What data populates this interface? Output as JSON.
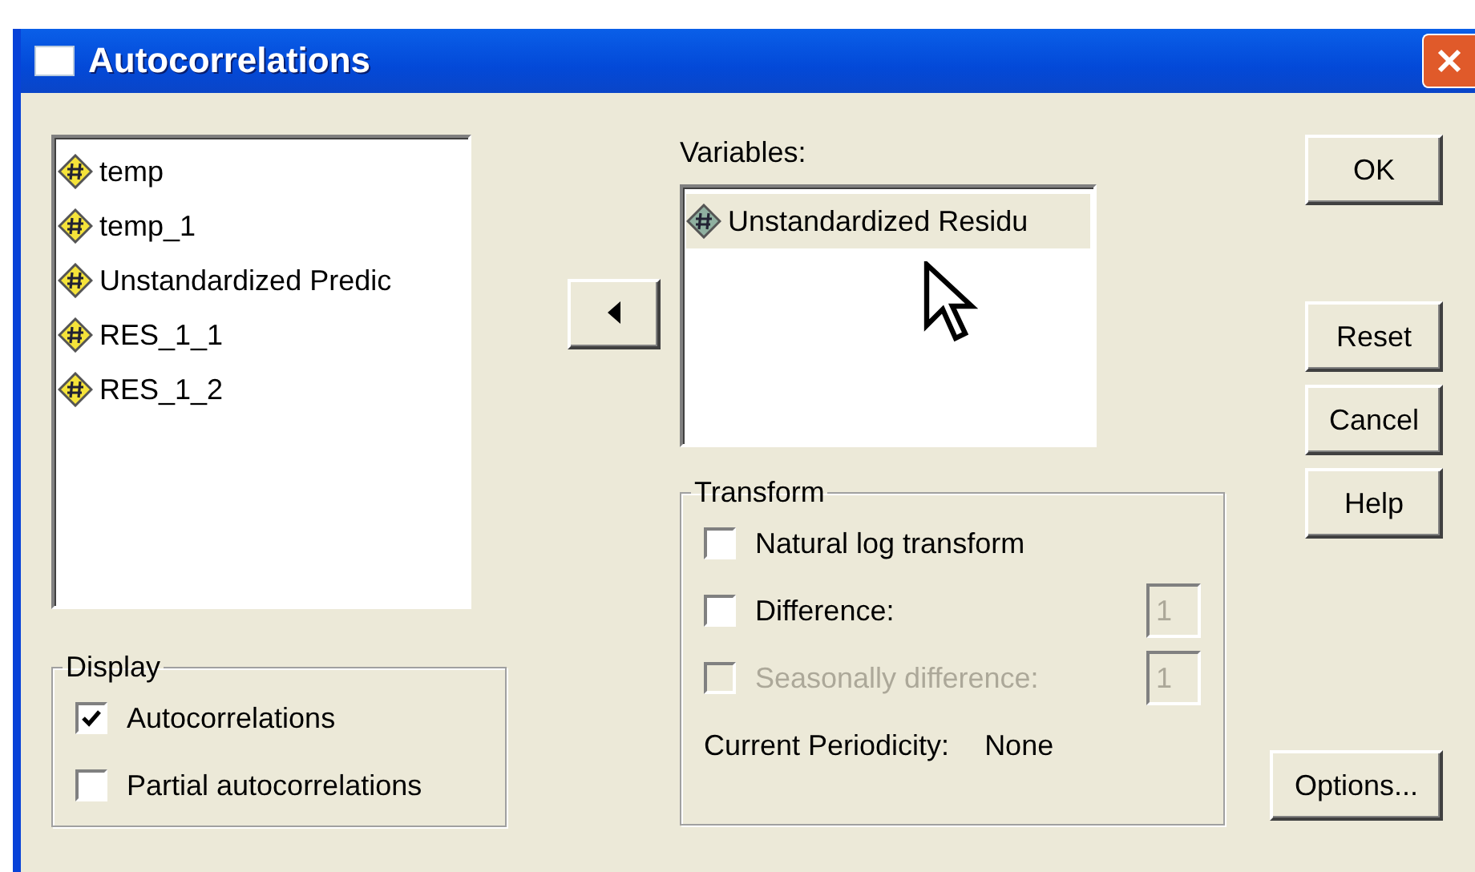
{
  "window": {
    "title": "Autocorrelations"
  },
  "source_list": {
    "items": [
      {
        "label": "temp",
        "selected": false
      },
      {
        "label": "temp_1",
        "selected": false
      },
      {
        "label": "Unstandardized Predic",
        "selected": false
      },
      {
        "label": "RES_1_1",
        "selected": false
      },
      {
        "label": "RES_1_2",
        "selected": false
      }
    ]
  },
  "variables": {
    "label": "Variables:",
    "items": [
      {
        "label": "Unstandardized Residu",
        "selected": true
      }
    ]
  },
  "display": {
    "legend": "Display",
    "options": [
      {
        "label": "Autocorrelations",
        "checked": true,
        "disabled": false
      },
      {
        "label": "Partial autocorrelations",
        "checked": false,
        "disabled": false
      }
    ]
  },
  "transform": {
    "legend": "Transform",
    "options": [
      {
        "label": "Natural log transform",
        "checked": false,
        "disabled": false
      },
      {
        "label": "Difference:",
        "checked": false,
        "disabled": false,
        "value": "1"
      },
      {
        "label": "Seasonally difference:",
        "checked": false,
        "disabled": true,
        "value": "1"
      }
    ],
    "periodicity_label": "Current Periodicity:",
    "periodicity_value": "None"
  },
  "buttons": {
    "ok": "OK",
    "reset": "Reset",
    "cancel": "Cancel",
    "help": "Help",
    "options": "Options..."
  }
}
